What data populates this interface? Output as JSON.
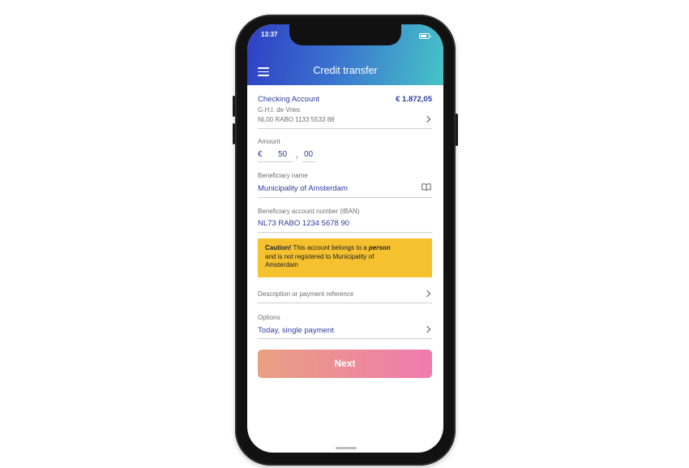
{
  "status": {
    "time": "13:37"
  },
  "header": {
    "title": "Credit transfer"
  },
  "account": {
    "name": "Checking Account",
    "balance": "€ 1.872,05",
    "holder": "G.H.I. de Vries",
    "iban": "NL00 RABO 1133 5533 88"
  },
  "amount": {
    "label": "Amount",
    "currency": "€",
    "whole": "50",
    "separator": ",",
    "cents": "00"
  },
  "beneficiary": {
    "name_label": "Beneficiary name",
    "name_value": "Municipality of Amsterdam"
  },
  "beneficiary_account": {
    "label": "Beneficiary account number (IBAN)",
    "value": "NL73 RABO 1234 5678 90"
  },
  "caution": {
    "title": "Caution!",
    "text1": " This account belongs to a ",
    "emphasis": "person",
    "text2": "and is not registered to Municipality of",
    "text3": "Amsterdam"
  },
  "description": {
    "label": "Description or payment reference"
  },
  "options": {
    "label": "Options",
    "value": "Today, single payment"
  },
  "next_button": {
    "label": "Next"
  },
  "icons": {
    "menu": "hamburger-icon",
    "chevron": "chevron-right-icon",
    "book": "address-book-icon",
    "battery": "battery-icon"
  },
  "colors": {
    "accent_blue": "#2f3c9e",
    "header_start": "#2f3fc4",
    "header_end": "#47c4c7",
    "caution": "#f5c12e",
    "button_start": "#e8a081",
    "button_end": "#f07aae"
  }
}
